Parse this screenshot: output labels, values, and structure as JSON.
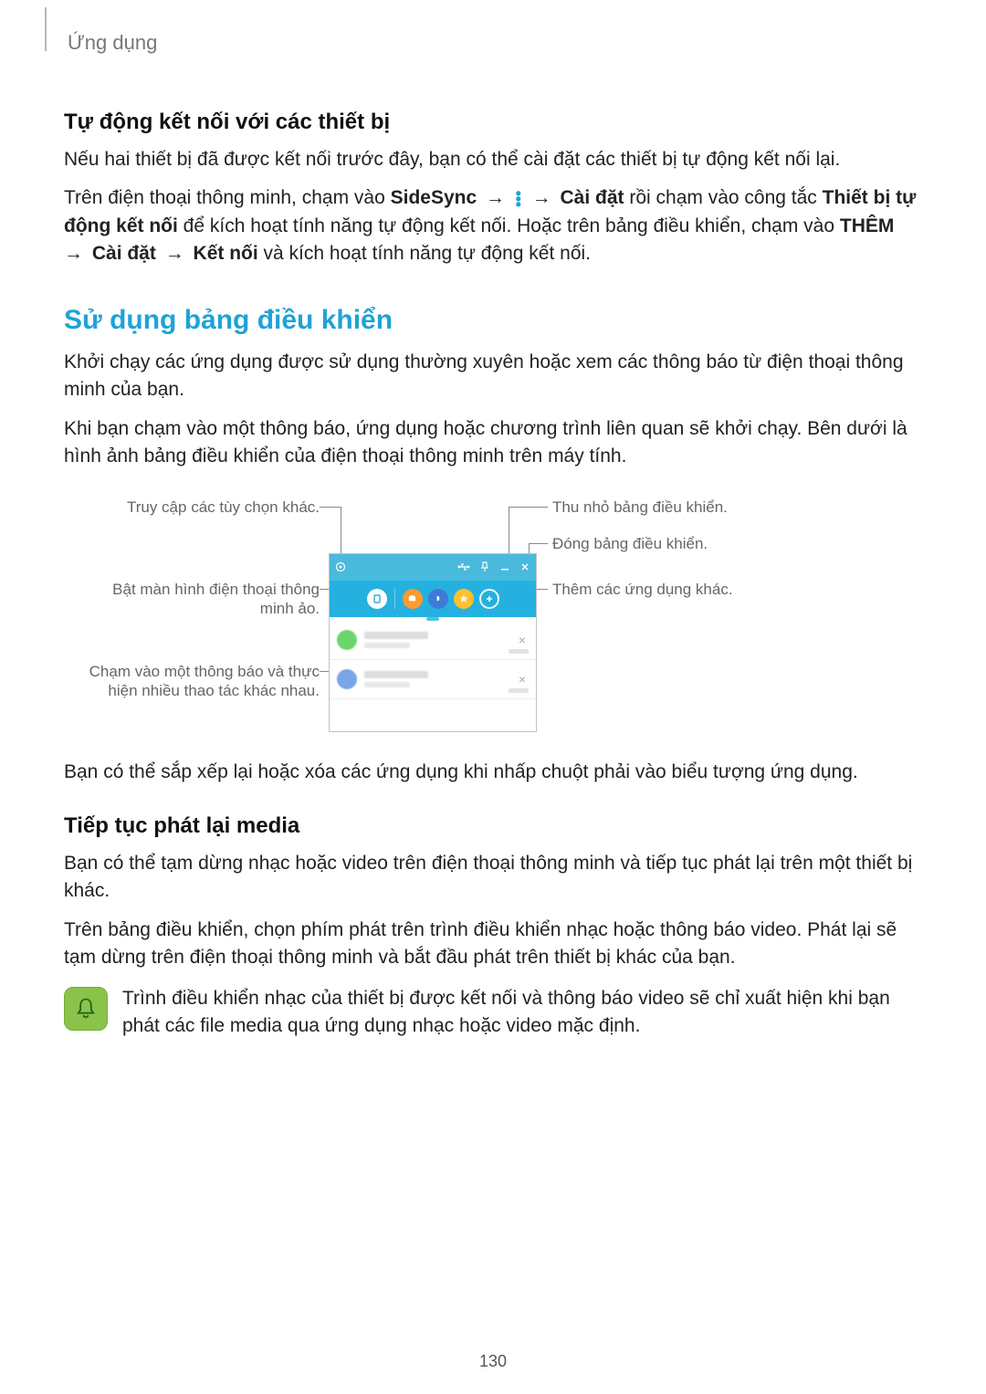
{
  "header": {
    "breadcrumb": "Ứng dụng"
  },
  "sec1": {
    "subhead": "Tự động kết nối với các thiết bị",
    "p1": "Nếu hai thiết bị đã được kết nối trước đây, bạn có thể cài đặt các thiết bị tự động kết nối lại.",
    "p2": {
      "t1": "Trên điện thoại thông minh, chạm vào ",
      "b1": "SideSync",
      "t2": " → ",
      "t3": " → ",
      "b2": "Cài đặt",
      "t4": " rồi chạm vào công tắc ",
      "b3": "Thiết bị tự động kết nối",
      "t5": " để kích hoạt tính năng tự động kết nối. Hoặc trên bảng điều khiển, chạm vào ",
      "b4": "THÊM",
      "t6": " → ",
      "b5": "Cài đặt",
      "t7": " → ",
      "b6": "Kết nối",
      "t8": " và kích hoạt tính năng tự động kết nối."
    }
  },
  "sec2": {
    "title": "Sử dụng bảng điều khiển",
    "p1": "Khởi chạy các ứng dụng được sử dụng thường xuyên hoặc xem các thông báo từ điện thoại thông minh của bạn.",
    "p2": "Khi bạn chạm vào một thông báo, ứng dụng hoặc chương trình liên quan sẽ khởi chạy. Bên dưới là hình ảnh bảng điều khiển của điện thoại thông minh trên máy tính.",
    "labels": {
      "l1": "Truy cập các tùy chọn khác.",
      "l2": "Bật màn hình điện thoại thông minh ảo.",
      "l3": "Chạm vào một thông báo và thực hiện nhiều thao tác khác nhau.",
      "r1": "Thu nhỏ bảng điều khiển.",
      "r2": "Đóng bảng điều khiển.",
      "r3": "Thêm các ứng dụng khác."
    },
    "p3": "Bạn có thể sắp xếp lại hoặc xóa các ứng dụng khi nhấp chuột phải vào biểu tượng ứng dụng."
  },
  "sec3": {
    "subhead": "Tiếp tục phát lại media",
    "p1": "Bạn có thể tạm dừng nhạc hoặc video trên điện thoại thông minh và tiếp tục phát lại trên một thiết bị khác.",
    "p2": "Trên bảng điều khiển, chọn phím phát trên trình điều khiển nhạc hoặc thông báo video. Phát lại sẽ tạm dừng trên điện thoại thông minh và bắt đầu phát trên thiết bị khác của bạn.",
    "note": "Trình điều khiển nhạc của thiết bị được kết nối và thông báo video sẽ chỉ xuất hiện khi bạn phát các file media qua ứng dụng nhạc hoặc video mặc định."
  },
  "page_number": "130"
}
